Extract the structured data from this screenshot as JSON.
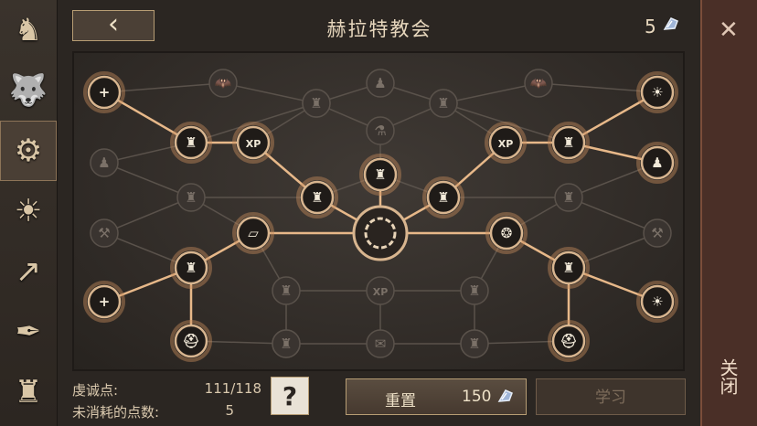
{
  "header": {
    "title": "赫拉特教会",
    "points": "5"
  },
  "sidebar": [
    {
      "name": "horse-tab",
      "icon": "horse-head-icon",
      "glyph": "♞"
    },
    {
      "name": "wolf-tab",
      "icon": "wolf-head-icon",
      "glyph": "🐺"
    },
    {
      "name": "skill-tree-tab",
      "icon": "network-icon",
      "glyph": "⚙"
    },
    {
      "name": "sun-scroll-tab",
      "icon": "sun-scroll-icon",
      "glyph": "☀"
    },
    {
      "name": "map-arrow-tab",
      "icon": "map-arrow-icon",
      "glyph": "↗"
    },
    {
      "name": "quill-tab",
      "icon": "quill-scroll-icon",
      "glyph": "✒"
    },
    {
      "name": "character-tab",
      "icon": "character-icon",
      "glyph": "♜"
    }
  ],
  "close": {
    "label": "关闭"
  },
  "footer": {
    "devotion_label": "虔诚点:",
    "devotion_value": "111/118",
    "unspent_label": "未消耗的点数:",
    "unspent_value": "5",
    "help_label": "?",
    "reset_label": "重置",
    "reset_cost": "150",
    "learn_label": "学习"
  },
  "colors": {
    "active_line": "#e7b889",
    "inactive_line": "#5a524b",
    "node_active_ring": "#d8b58f"
  },
  "tree": {
    "center": {
      "icon": "sun-emblem-icon"
    },
    "nodes": [
      {
        "id": "n1",
        "icon": "medic-cross-icon",
        "active": true
      },
      {
        "id": "n2",
        "icon": "castle-icon",
        "active": true
      },
      {
        "id": "n3",
        "icon": "xp-horse-icon",
        "active": true,
        "text": "XP"
      },
      {
        "id": "n4",
        "icon": "castle-icon",
        "active": true
      },
      {
        "id": "n5",
        "icon": "castle-icon",
        "active": true
      },
      {
        "id": "n6",
        "icon": "xp-horse-icon",
        "active": true,
        "text": "XP"
      },
      {
        "id": "n7",
        "icon": "castle-icon",
        "active": true
      },
      {
        "id": "n8",
        "icon": "sun-icon",
        "active": true
      },
      {
        "id": "n9",
        "icon": "soldier-icon",
        "active": true
      },
      {
        "id": "n10",
        "icon": "bread-icon",
        "active": true
      },
      {
        "id": "n11",
        "icon": "castle-icon",
        "active": true
      },
      {
        "id": "n12",
        "icon": "medic-cross-icon",
        "active": true
      },
      {
        "id": "n13",
        "icon": "helmet-icon",
        "active": true
      },
      {
        "id": "n14",
        "icon": "granary-icon",
        "active": true
      },
      {
        "id": "n15",
        "icon": "castle-icon",
        "active": true
      },
      {
        "id": "n16",
        "icon": "sun-icon",
        "active": true
      },
      {
        "id": "n17",
        "icon": "helmet-icon",
        "active": true
      },
      {
        "id": "n18",
        "icon": "castle-icon",
        "active": true
      },
      {
        "id": "n19",
        "icon": "castle-icon",
        "active": false
      },
      {
        "id": "n20",
        "icon": "castle-icon",
        "active": false
      },
      {
        "id": "n21",
        "icon": "xp-horse-icon",
        "active": false,
        "text": "XP"
      },
      {
        "id": "n22",
        "icon": "castle-icon",
        "active": false
      },
      {
        "id": "n23",
        "icon": "castle-icon",
        "active": false
      },
      {
        "id": "n24",
        "icon": "bat-icon",
        "active": false
      },
      {
        "id": "n25",
        "icon": "castle-icon",
        "active": false
      },
      {
        "id": "n26",
        "icon": "soldier-icon",
        "active": false
      },
      {
        "id": "n27",
        "icon": "castle-icon",
        "active": false
      },
      {
        "id": "n28",
        "icon": "bat-icon",
        "active": false
      },
      {
        "id": "n29",
        "icon": "soldier-icon",
        "active": false
      },
      {
        "id": "n30",
        "icon": "castle-icon",
        "active": false
      },
      {
        "id": "n31",
        "icon": "potion-icon",
        "active": false
      },
      {
        "id": "n32",
        "icon": "castle-icon",
        "active": false
      },
      {
        "id": "n33",
        "icon": "castle-icon",
        "active": false
      },
      {
        "id": "n34",
        "icon": "hammer-icon",
        "active": false
      },
      {
        "id": "n35",
        "icon": "hammer-icon",
        "active": false
      },
      {
        "id": "n36",
        "icon": "castle-icon",
        "active": false
      },
      {
        "id": "n37",
        "icon": "castle-icon",
        "active": false
      },
      {
        "id": "n38",
        "icon": "scroll-icon",
        "active": false
      },
      {
        "id": "n39",
        "icon": "castle-icon",
        "active": false
      }
    ]
  }
}
